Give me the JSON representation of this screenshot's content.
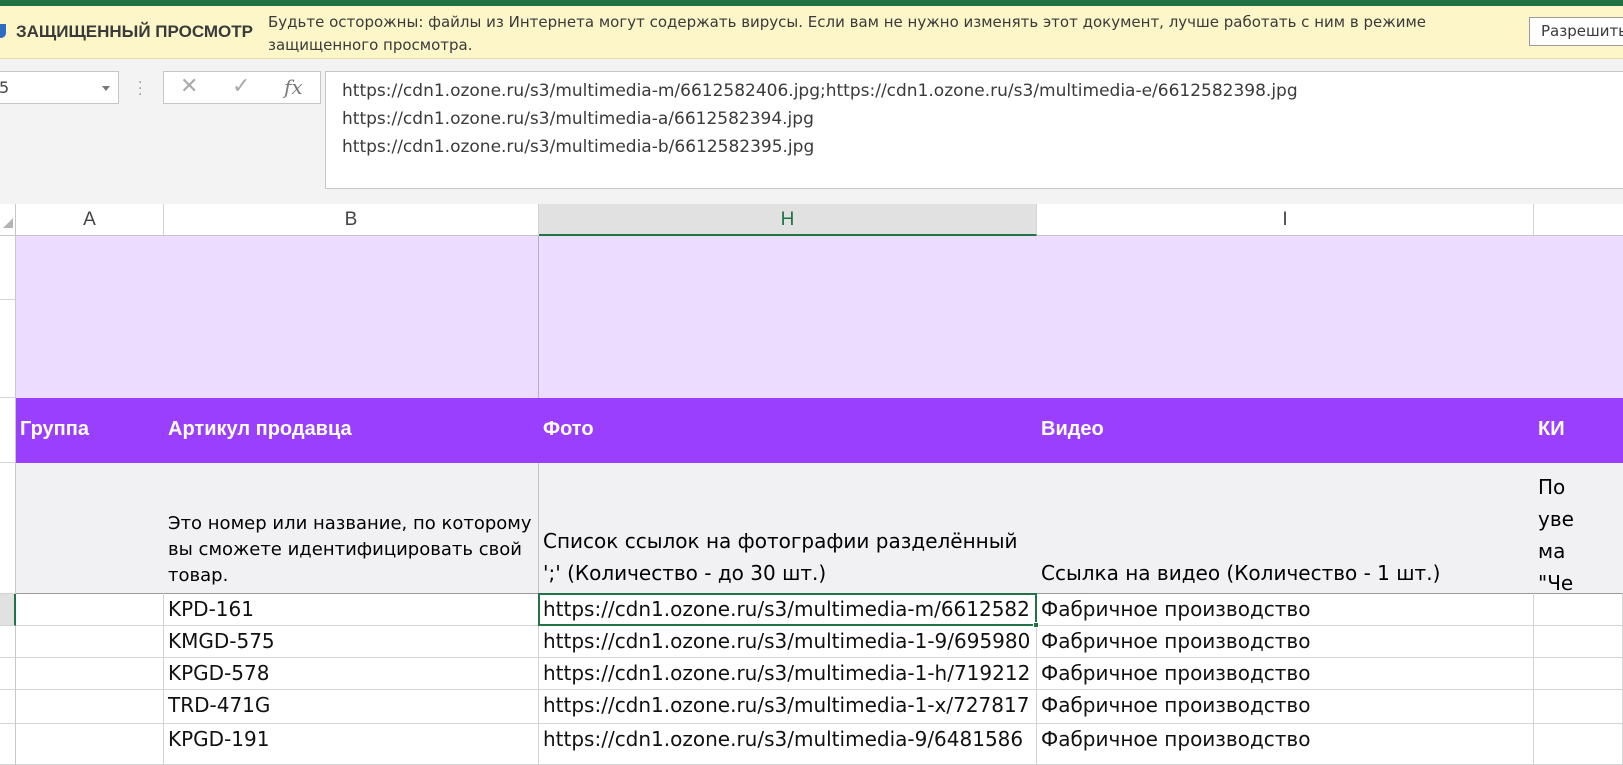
{
  "protected_view": {
    "title": "ЗАЩИЩЕННЫЙ ПРОСМОТР",
    "message": "Будьте осторожны: файлы из Интернета могут содержать вирусы. Если вам не нужно изменять этот документ, лучше работать с ним в режиме защищенного просмотра.",
    "enable_button": "Разрешить редактирование"
  },
  "formula_bar": {
    "name_box": "5",
    "cancel_icon": "✕",
    "enter_icon": "✓",
    "function_icon": "fx",
    "content": "https://cdn1.ozone.ru/s3/multimedia-m/6612582406.jpg;https://cdn1.ozone.ru/s3/multimedia-e/6612582398.jpg\nhttps://cdn1.ozone.ru/s3/multimedia-a/6612582394.jpg\nhttps://cdn1.ozone.ru/s3/multimedia-b/6612582395.jpg"
  },
  "columns": [
    "A",
    "B",
    "H",
    "I"
  ],
  "header_row": {
    "group": "Группа",
    "seller_sku": "Артикул продавца",
    "photo": "Фото",
    "video": "Видео",
    "next": "КИ"
  },
  "description_row": {
    "group": "",
    "seller_sku": "Это номер или название, по которому вы сможете идентифицировать свой товар.",
    "photo": "Список ссылок на фотографии разделённый ';' (Количество - до 30 шт.)",
    "video": "Ссылка на видео (Количество - 1 шт.)",
    "next": "По уве ма \"Че"
  },
  "rows": [
    {
      "a": "",
      "b": "KPD-161",
      "h": "https://cdn1.ozone.ru/s3/multimedia-m/6612582",
      "i": "Фабричное производство"
    },
    {
      "a": "",
      "b": "KMGD-575",
      "h": "https://cdn1.ozone.ru/s3/multimedia-1-9/695980",
      "i": "Фабричное производство"
    },
    {
      "a": "",
      "b": "KPGD-578",
      "h": "https://cdn1.ozone.ru/s3/multimedia-1-h/719212",
      "i": "Фабричное производство"
    },
    {
      "a": "",
      "b": "TRD-471G",
      "h": "https://cdn1.ozone.ru/s3/multimedia-1-x/727817",
      "i": "Фабричное производство"
    },
    {
      "a": "",
      "b": "KPGD-191",
      "h": "https://cdn1.ozone.ru/s3/multimedia-9/6481586",
      "i": "Фабричное производство"
    }
  ]
}
